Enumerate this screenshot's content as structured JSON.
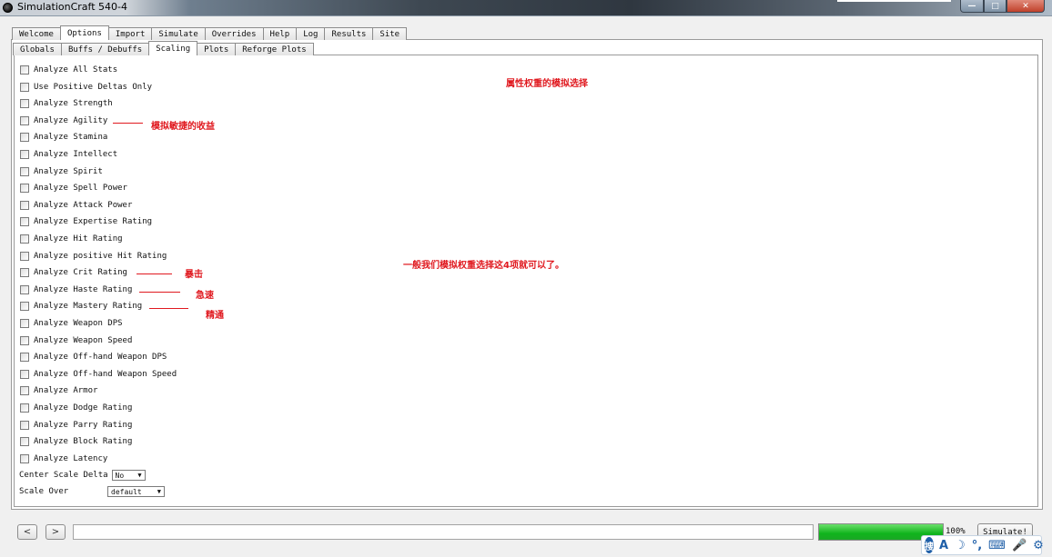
{
  "window": {
    "title": "SimulationCraft 540-4",
    "min_glyph": "—",
    "max_glyph": "□",
    "close_glyph": "✕"
  },
  "main_tabs": [
    "Welcome",
    "Options",
    "Import",
    "Simulate",
    "Overrides",
    "Help",
    "Log",
    "Results",
    "Site"
  ],
  "sub_tabs": [
    "Globals",
    "Buffs / Debuffs",
    "Scaling",
    "Plots",
    "Reforge Plots"
  ],
  "scaling_options": [
    "Analyze All Stats",
    "Use Positive Deltas Only",
    "Analyze Strength",
    "Analyze Agility",
    "Analyze Stamina",
    "Analyze Intellect",
    "Analyze Spirit",
    "Analyze Spell Power",
    "Analyze Attack Power",
    "Analyze Expertise Rating",
    "Analyze Hit Rating",
    "Analyze positive Hit Rating",
    "Analyze Crit Rating",
    "Analyze Haste Rating",
    "Analyze Mastery Rating",
    "Analyze Weapon DPS",
    "Analyze Weapon Speed",
    "Analyze Off-hand Weapon DPS",
    "Analyze Off-hand Weapon Speed",
    "Analyze Armor",
    "Analyze Dodge Rating",
    "Analyze Parry Rating",
    "Analyze Block Rating",
    "Analyze Latency"
  ],
  "center_scale_delta": {
    "label": "Center Scale Delta",
    "value": "No"
  },
  "scale_over": {
    "label": "Scale Over",
    "value": "default"
  },
  "annotations": {
    "heading": "属性权重的模拟选择",
    "agility": "模拟敏捷的收益",
    "summary": "一般我们模拟权重选择这4项就可以了。",
    "crit": "暴击",
    "haste": "急速",
    "mastery": "精通"
  },
  "bottom_bar": {
    "back_glyph": "<",
    "forward_glyph": ">",
    "progress_percent": 100,
    "progress_label": "100%",
    "simulate_label": "Simulate!"
  },
  "ime_toolbar": {
    "logo": "搜",
    "glyphs": [
      "A",
      "☽",
      "°,",
      "⌨",
      "🎤",
      "⚙"
    ]
  }
}
